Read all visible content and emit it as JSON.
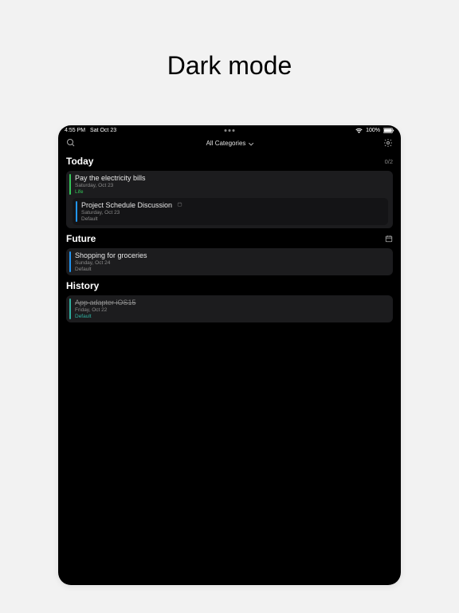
{
  "hero": {
    "title": "Dark mode"
  },
  "status_bar": {
    "time": "4:55 PM",
    "date": "Sat Oct 23",
    "wifi": true,
    "battery_pct": "100%"
  },
  "topbar": {
    "filter_label": "All Categories"
  },
  "sections": {
    "today": {
      "title": "Today",
      "counter": "0/2",
      "tasks": [
        {
          "title": "Pay the electricity bills",
          "date": "Saturday, Oct 23",
          "category": "Life",
          "bar": "green",
          "cat_color": "green"
        },
        {
          "title": "Project Schedule Discussion",
          "date": "Saturday, Oct 23",
          "category": "Default",
          "bar": "blue",
          "cat_color": "",
          "note_icon": true
        }
      ]
    },
    "future": {
      "title": "Future",
      "tasks": [
        {
          "title": "Shopping for groceries",
          "date": "Sunday, Oct 24",
          "category": "Default",
          "bar": "blue",
          "cat_color": ""
        }
      ]
    },
    "history": {
      "title": "History",
      "tasks": [
        {
          "title": "App adapter iOS15",
          "date": "Friday, Oct 22",
          "category": "Default",
          "bar": "teal",
          "cat_color": "teal",
          "done": true
        }
      ]
    }
  }
}
